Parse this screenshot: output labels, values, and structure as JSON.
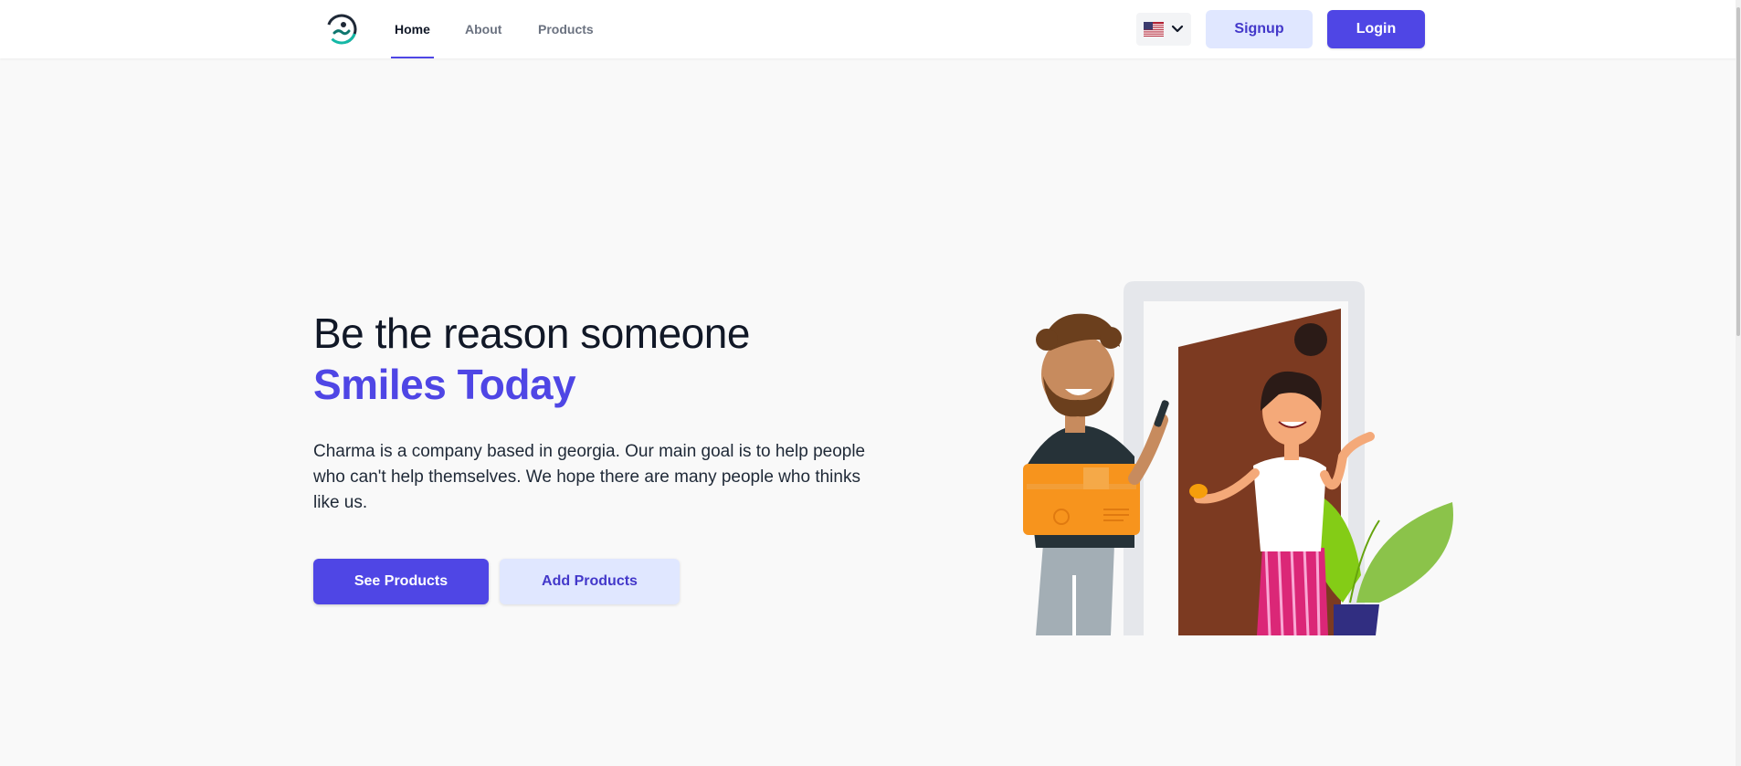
{
  "nav": {
    "home": "Home",
    "about": "About",
    "products": "Products",
    "language_icon": "us-flag-icon",
    "signup": "Signup",
    "login": "Login"
  },
  "hero": {
    "title_line1": "Be the reason someone",
    "title_line2": "Smiles Today",
    "description": "Charma is a company based in georgia. Our main goal is to help people who can't help themselves. We hope there are many people who thinks like us.",
    "see_products": "See Products",
    "add_products": "Add Products"
  },
  "colors": {
    "accent": "#4f46e5",
    "accent_light": "#e0e7ff",
    "background": "#f9f9f9"
  }
}
